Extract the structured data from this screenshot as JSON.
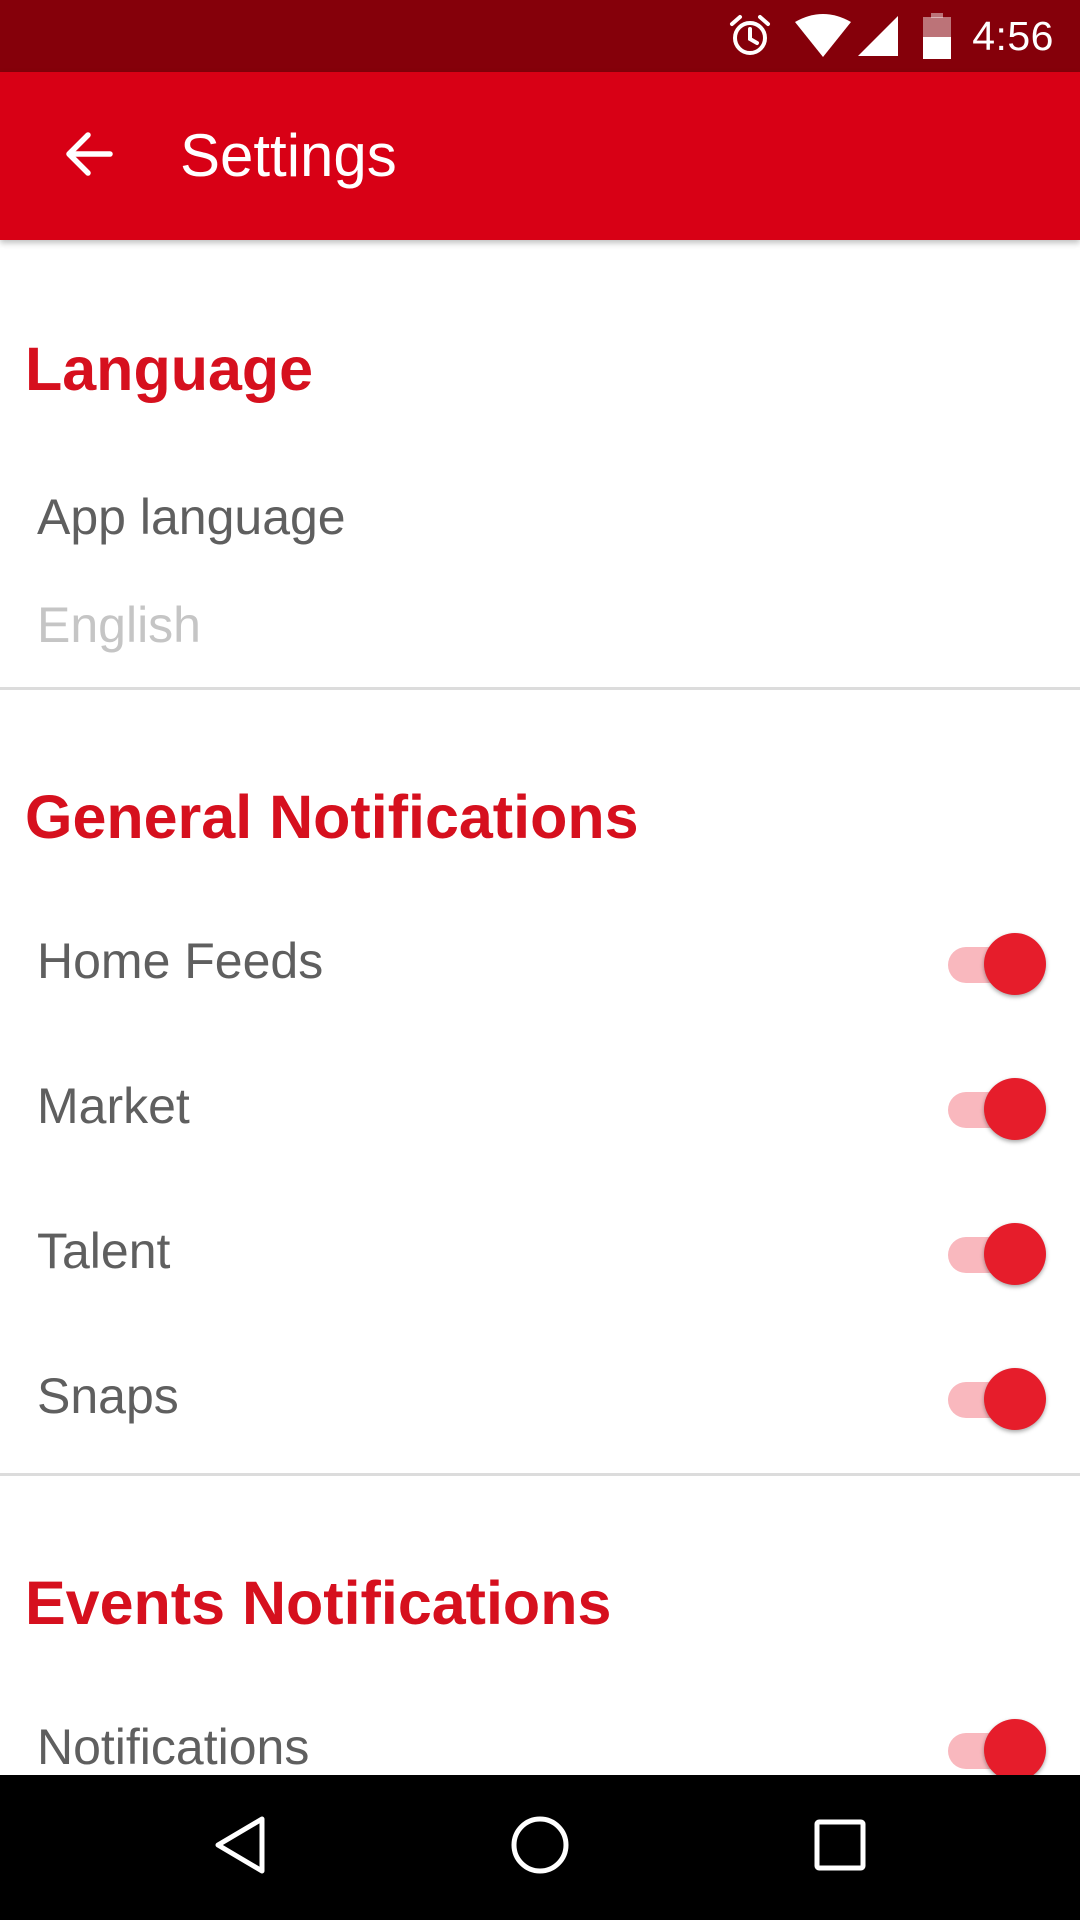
{
  "status_bar": {
    "time": "4:56",
    "icons": [
      "alarm-icon",
      "wifi-icon",
      "cell-signal-icon",
      "battery-icon"
    ]
  },
  "app_bar": {
    "title": "Settings",
    "back_icon": "arrow-left-icon",
    "background_color": "#d80015"
  },
  "sections": {
    "language": {
      "header": "Language",
      "app_language_title": "App language",
      "app_language_value": "English"
    },
    "general": {
      "header": "General Notifications",
      "items": [
        {
          "label": "Home Feeds",
          "enabled": true
        },
        {
          "label": "Market",
          "enabled": true
        },
        {
          "label": "Talent",
          "enabled": true
        },
        {
          "label": "Snaps",
          "enabled": true
        }
      ]
    },
    "events": {
      "header": "Events Notifications",
      "items": [
        {
          "label": "Notifications",
          "enabled": true
        }
      ]
    }
  },
  "colors": {
    "accent": "#d6101e",
    "status_bar": "#85000a",
    "switch_on_thumb": "#e61d2b",
    "switch_on_track": "#f9b8be"
  },
  "nav_bar": {
    "icons": [
      "back-triangle-icon",
      "home-circle-icon",
      "recents-square-icon"
    ]
  }
}
